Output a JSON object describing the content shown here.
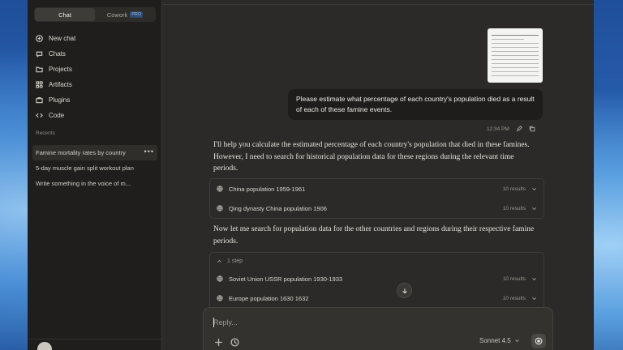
{
  "sidebar": {
    "modes": [
      {
        "label": "Chat",
        "active": true
      },
      {
        "label": "Cowork",
        "badge": "PRO",
        "active": false
      }
    ],
    "nav": [
      {
        "label": "New chat",
        "icon": "plus-icon"
      },
      {
        "label": "Chats",
        "icon": "chat-bubble-icon"
      },
      {
        "label": "Projects",
        "icon": "folder-icon"
      },
      {
        "label": "Artifacts",
        "icon": "artifacts-grid-icon"
      },
      {
        "label": "Plugins",
        "icon": "briefcase-icon"
      },
      {
        "label": "Code",
        "icon": "code-brackets-icon"
      }
    ],
    "recents_label": "Recents",
    "recents": [
      {
        "label": "Famine mortality rates by country",
        "active": true
      },
      {
        "label": "5-day muscle gain split workout plan",
        "active": false
      },
      {
        "label": "Write something in the voice of m...",
        "active": false
      }
    ]
  },
  "conversation": {
    "user_message": "Please estimate what percentage of each country's population died as a result of each of these famine events.",
    "user_time": "12:34 PM",
    "assistant_p1": "I'll help you calculate the estimated percentage of each country's population that died in these famines. However, I need to search for historical population data for these regions during the relevant time periods.",
    "searches_1": [
      {
        "query": "China population 1959-1961",
        "results": "10 results"
      },
      {
        "query": "Qing dynasty China population 1906",
        "results": "10 results"
      }
    ],
    "assistant_p2": "Now let me search for population data for the other countries and regions during their respective famine periods.",
    "step_label": "1 step",
    "searches_2": [
      {
        "query": "Soviet Union USSR population 1930-1933",
        "results": "10 results"
      },
      {
        "query": "Europe population 1630 1632",
        "results": "10 results"
      }
    ]
  },
  "composer": {
    "placeholder": "Reply...",
    "model": "Sonnet 4.5"
  },
  "colors": {
    "sidebar_bg": "#1f1e1c",
    "main_bg": "#2b2a28",
    "bubble_bg": "#1e1d1b",
    "composer_bg": "#33322f"
  }
}
